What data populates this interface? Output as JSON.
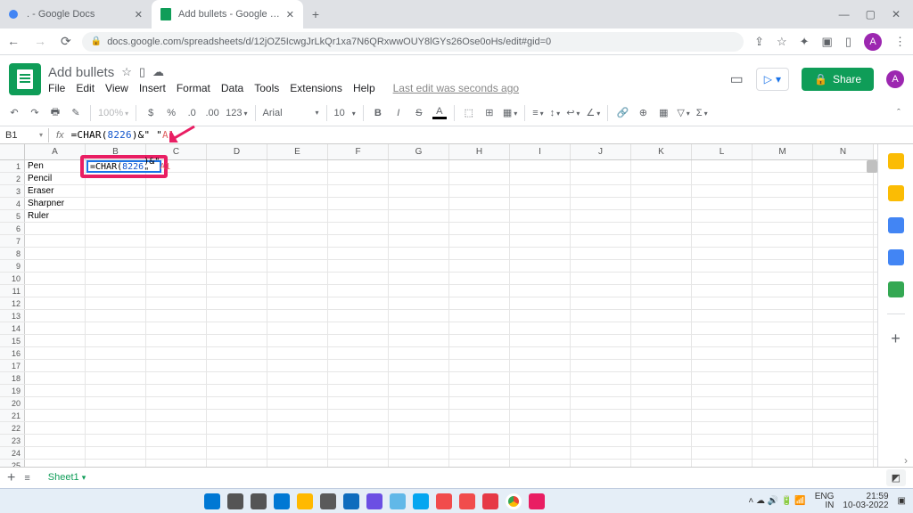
{
  "browser": {
    "tabs": [
      {
        "title": ". - Google Docs",
        "icon_color": "#4285f4"
      },
      {
        "title": "Add bullets - Google Sheets",
        "icon_color": "#0f9d58"
      }
    ],
    "url": "docs.google.com/spreadsheets/d/12jOZ5IcwgJrLkQr1xa7N6QRxwwOUY8lGYs26Ose0oHs/edit#gid=0",
    "win_min": "—",
    "win_max": "▢",
    "win_close": "✕",
    "nav_back": "←",
    "nav_fwd": "→",
    "nav_reload": "⟳",
    "ext_share": "☆",
    "ext_puzzle": "✦",
    "ext_star": "★",
    "avatar_letter": "A"
  },
  "doc": {
    "title": "Add bullets",
    "star": "☆",
    "move": "▯",
    "cloud": "☁",
    "menus": [
      "File",
      "Edit",
      "View",
      "Insert",
      "Format",
      "Data",
      "Tools",
      "Extensions",
      "Help"
    ],
    "status": "Last edit was seconds ago",
    "share_label": "Share",
    "present_caret": "▾",
    "chat_icon": "▭",
    "avatar_letter": "A"
  },
  "toolbar": {
    "undo": "↶",
    "redo": "↷",
    "print": "🖶",
    "paint": "✎",
    "zoom": "100%",
    "currency": "$",
    "percent": "%",
    "dec0": ".0",
    "dec00": ".00",
    "numfmt": "123",
    "font": "Arial",
    "size": "10",
    "bold": "B",
    "italic": "I",
    "strike": "S",
    "color": "A",
    "fill": "⬚",
    "borders": "⊞",
    "merge": "▦",
    "halign": "≡",
    "valign": "↕",
    "wrap": "↩",
    "rotate": "∠",
    "link": "🔗",
    "comment": "⊕",
    "chart": "▦",
    "filter": "▽",
    "funcs": "Σ",
    "chev": "ˆ"
  },
  "name_box": "B1",
  "formula": {
    "prefix": "=CHAR(",
    "arg": "8226",
    "mid": ")&\" \"",
    "amp2": "",
    "ref": "A1"
  },
  "columns": [
    "A",
    "B",
    "C",
    "D",
    "E",
    "F",
    "G",
    "H",
    "I",
    "J",
    "K",
    "L",
    "M",
    "N"
  ],
  "cells_colA": [
    "Pen",
    "Pencil",
    "Eraser",
    "Sharpner",
    "Ruler"
  ],
  "row_count": 26,
  "cell_edit_display": {
    "prefix": "=CHAR(",
    "arg": "8226",
    "mid": ")&\" \"",
    "ref": "A1"
  },
  "sheet_tabs": {
    "add": "+",
    "all": "≡",
    "name": "Sheet1",
    "caret": "▾",
    "explore": "◩"
  },
  "side_panel": [
    {
      "bg": "#fbbc04",
      "name": "calendar-icon"
    },
    {
      "bg": "#fbbc04",
      "name": "keep-icon"
    },
    {
      "bg": "#4285f4",
      "name": "tasks-icon"
    },
    {
      "bg": "#4285f4",
      "name": "contacts-icon"
    },
    {
      "bg": "#34a853",
      "name": "maps-icon"
    },
    {
      "bg": "#ffffff",
      "name": "divider"
    },
    {
      "bg": "#5f6368",
      "name": "plus-icon"
    }
  ],
  "taskbar": {
    "apps": [
      {
        "bg": "#0078d4",
        "name": "start-icon"
      },
      {
        "bg": "#555",
        "name": "search-icon"
      },
      {
        "bg": "#555",
        "name": "task-view-icon"
      },
      {
        "bg": "#0078d4",
        "name": "widgets-icon"
      },
      {
        "bg": "#ffb900",
        "name": "explorer-icon"
      },
      {
        "bg": "#5a5a5a",
        "name": "settings-icon"
      },
      {
        "bg": "#0f6cbd",
        "name": "app1-icon"
      },
      {
        "bg": "#6b4fe3",
        "name": "app2-icon"
      },
      {
        "bg": "#61b8e8",
        "name": "app3-icon"
      },
      {
        "bg": "#05a6f0",
        "name": "app4-icon"
      },
      {
        "bg": "#f14c4c",
        "name": "app5-icon"
      },
      {
        "bg": "#f14c4c",
        "name": "app6-icon"
      },
      {
        "bg": "#e63946",
        "name": "app7-icon"
      },
      {
        "bg": "#fff",
        "name": "chrome-icon"
      },
      {
        "bg": "#e91e63",
        "name": "app8-icon"
      }
    ],
    "tray_icons": "˄  ☁  🔊  🔋  📶",
    "lang1": "ENG",
    "lang2": "IN",
    "time": "21:59",
    "date": "10-03-2022"
  }
}
